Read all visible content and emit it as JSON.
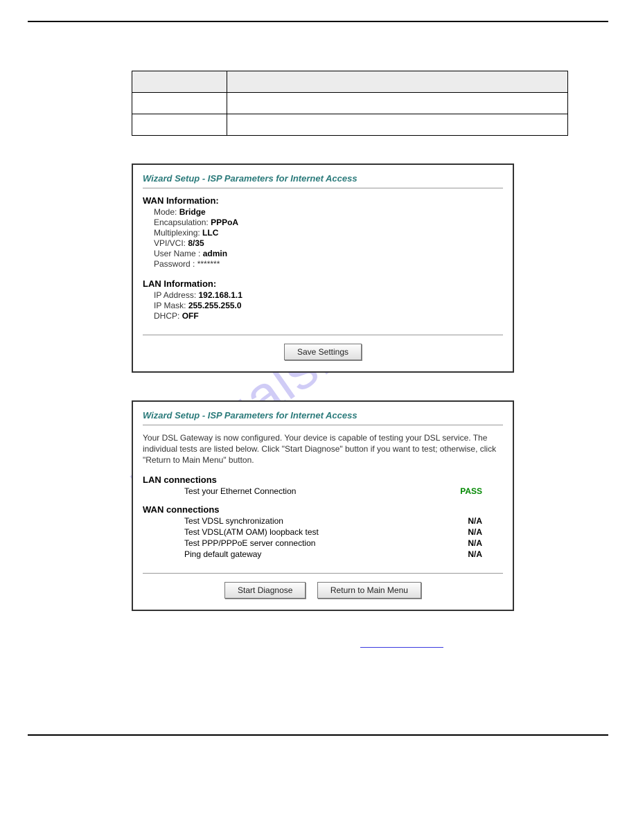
{
  "watermark": "manualshive.com",
  "doc_table": {
    "header_cells": [
      "",
      ""
    ],
    "rows": [
      [
        "",
        ""
      ],
      [
        "",
        ""
      ]
    ]
  },
  "panel1": {
    "title": "Wizard Setup - ISP Parameters for Internet Access",
    "wan_section": "WAN Information:",
    "wan": [
      {
        "label": "Mode:",
        "value": "Bridge"
      },
      {
        "label": "Encapsulation:",
        "value": "PPPoA"
      },
      {
        "label": "Multiplexing:",
        "value": "LLC"
      },
      {
        "label": "VPI/VCI:",
        "value": "8/35"
      },
      {
        "label": "User Name :",
        "value": "admin"
      },
      {
        "label": "Password :",
        "value": "*******"
      }
    ],
    "lan_section": "LAN Information:",
    "lan": [
      {
        "label": "IP Address:",
        "value": "192.168.1.1"
      },
      {
        "label": "IP Mask:",
        "value": "255.255.255.0"
      },
      {
        "label": "DHCP:",
        "value": "OFF"
      }
    ],
    "save_btn": "Save Settings"
  },
  "panel2": {
    "title": "Wizard Setup - ISP Parameters for Internet Access",
    "note": "Your DSL Gateway is now configured. Your device is capable of testing your DSL service. The individual tests are listed below. Click \"Start Diagnose\" button if you want to test; otherwise, click \"Return to Main Menu\" button.",
    "lan_section": "LAN connections",
    "lan_tests": [
      {
        "name": "Test your Ethernet Connection",
        "result": "PASS",
        "class": "pass"
      }
    ],
    "wan_section": "WAN connections",
    "wan_tests": [
      {
        "name": "Test VDSL synchronization",
        "result": "N/A",
        "class": "na"
      },
      {
        "name": "Test VDSL(ATM OAM) loopback test",
        "result": "N/A",
        "class": "na"
      },
      {
        "name": "Test PPP/PPPoE server connection",
        "result": "N/A",
        "class": "na"
      },
      {
        "name": "Ping default gateway",
        "result": "N/A",
        "class": "na"
      }
    ],
    "start_btn": "Start Diagnose",
    "return_btn": "Return to Main Menu"
  }
}
